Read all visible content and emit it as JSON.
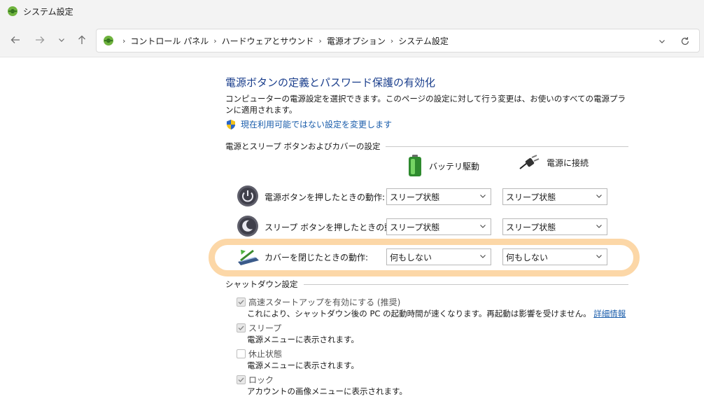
{
  "window": {
    "title": "システム設定"
  },
  "breadcrumb": [
    "コントロール パネル",
    "ハードウェアとサウンド",
    "電源オプション",
    "システム設定"
  ],
  "page": {
    "title": "電源ボタンの定義とパスワード保護の有効化",
    "description": "コンピューターの電源設定を選択できます。このページの設定に対して行う変更は、お使いのすべての電源プランに適用されます。",
    "change_link": "現在利用可能ではない設定を変更します"
  },
  "buttons_section": {
    "heading": "電源とスリープ ボタンおよびカバーの設定",
    "col_battery": "バッテリ駆動",
    "col_plugged": "電源に接続",
    "rows": [
      {
        "label": "電源ボタンを押したときの動作:",
        "battery": "スリープ状態",
        "plugged": "スリープ状態"
      },
      {
        "label": "スリープ ボタンを押したときの動作:",
        "battery": "スリープ状態",
        "plugged": "スリープ状態"
      },
      {
        "label": "カバーを閉じたときの動作:",
        "battery": "何もしない",
        "plugged": "何もしない"
      }
    ]
  },
  "shutdown_section": {
    "heading": "シャットダウン設定",
    "items": [
      {
        "label": "高速スタートアップを有効にする (推奨)",
        "checked": true,
        "desc": "これにより、シャットダウン後の PC の起動時間が速くなります。再起動は影響を受けません。",
        "link": "詳細情報"
      },
      {
        "label": "スリープ",
        "checked": true,
        "desc": "電源メニューに表示されます。"
      },
      {
        "label": "休止状態",
        "checked": false,
        "desc": "電源メニューに表示されます。"
      },
      {
        "label": "ロック",
        "checked": true,
        "desc": "アカウントの画像メニューに表示されます。"
      }
    ]
  },
  "colors": {
    "link": "#1a5dab",
    "title": "#1a3e8c",
    "highlight": "#fcd098"
  }
}
